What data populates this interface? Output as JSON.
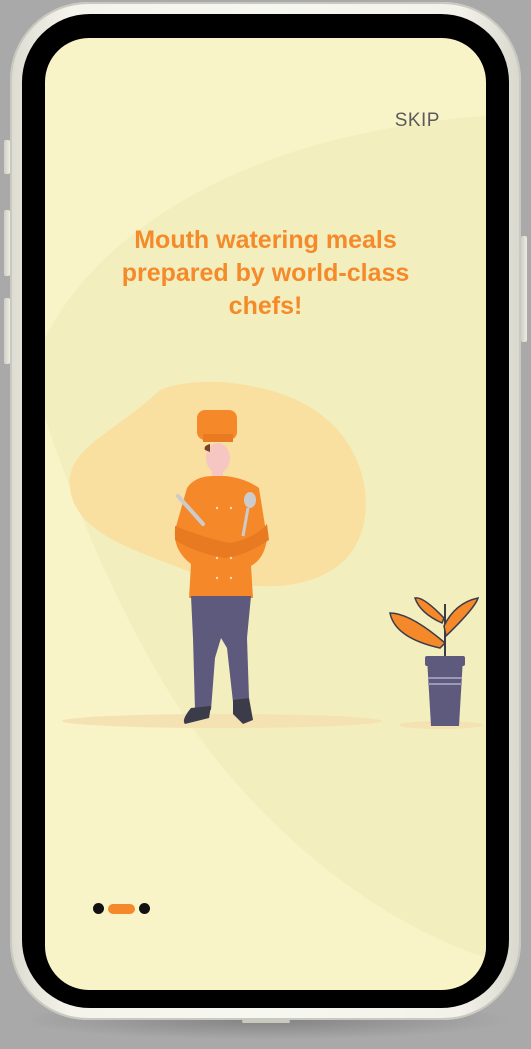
{
  "onboarding": {
    "skip_label": "SKIP",
    "headline_lines": [
      "Mouth watering meals",
      "prepared by world-class",
      "chefs!"
    ],
    "illustration_name": "chef-illustration",
    "plant_name": "potted-plant",
    "pagination": {
      "total": 3,
      "active_index": 1
    }
  },
  "colors": {
    "screen_background": "#f8f4c7",
    "accent": "#f58a2a",
    "text_muted": "#5b5b5b",
    "pants": "#5d5a7e"
  }
}
